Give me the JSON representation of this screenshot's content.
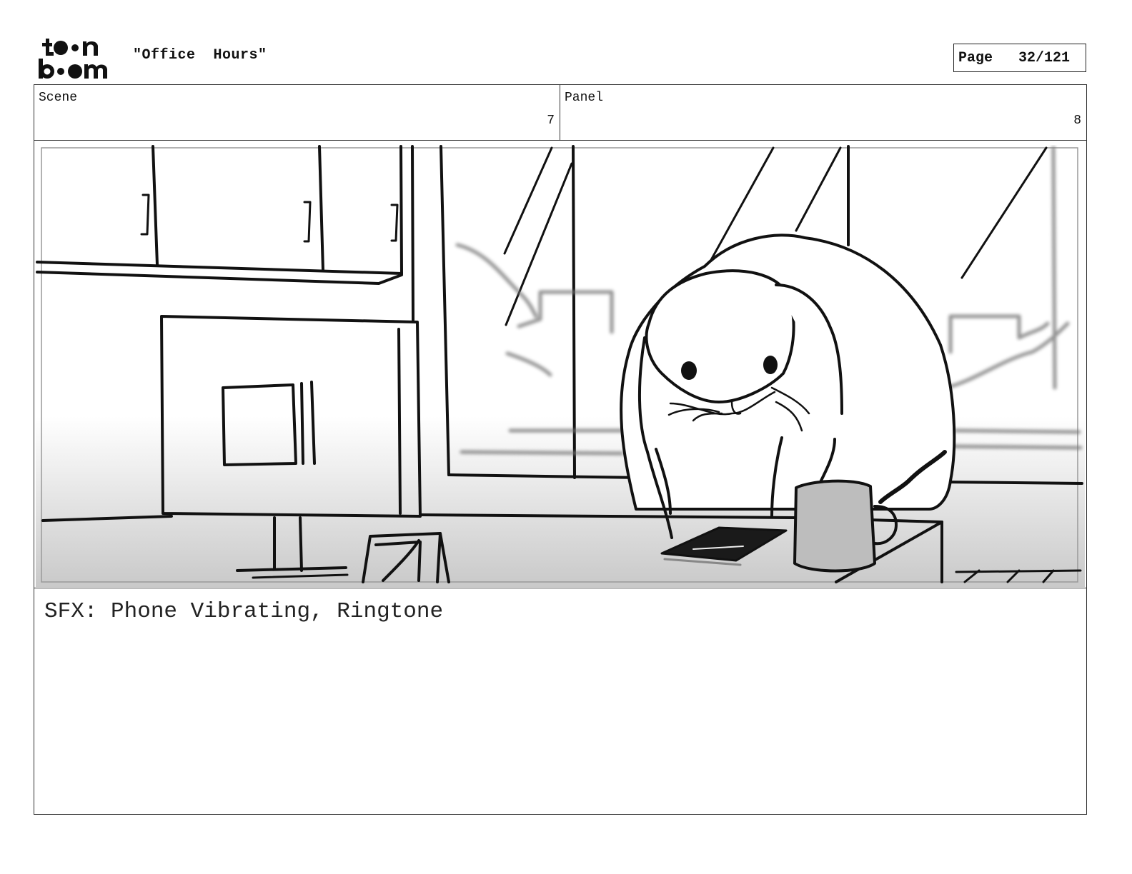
{
  "header": {
    "logo_text": "toon boom",
    "title": "\"Office  Hours\"",
    "page_label": "Page",
    "page_number": "32/121"
  },
  "storyboard": {
    "scene_label": "Scene",
    "scene_value": "7",
    "panel_label": "Panel",
    "panel_value": "8"
  },
  "notes": {
    "text": "SFX: Phone Vibrating, Ringtone"
  },
  "icons": [
    "toon-boom-logo"
  ]
}
